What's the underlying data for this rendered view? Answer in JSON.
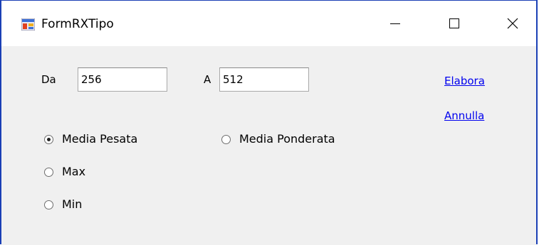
{
  "window": {
    "title": "FormRXTipo",
    "accent_color": "#1a3fb5"
  },
  "titlebar_buttons": {
    "minimize_icon": "minimize-icon",
    "maximize_icon": "maximize-icon",
    "close_icon": "close-icon"
  },
  "form": {
    "from_label": "Da",
    "from_value": "256",
    "to_label": "A",
    "to_value": "512"
  },
  "links": {
    "elabora": "Elabora",
    "annulla": "Annulla",
    "color": "#0000ee"
  },
  "radios": [
    {
      "label": "Media Pesata",
      "checked": true
    },
    {
      "label": "Media Ponderata",
      "checked": false
    },
    {
      "label": "Max",
      "checked": false
    },
    {
      "label": "Min",
      "checked": false
    }
  ]
}
